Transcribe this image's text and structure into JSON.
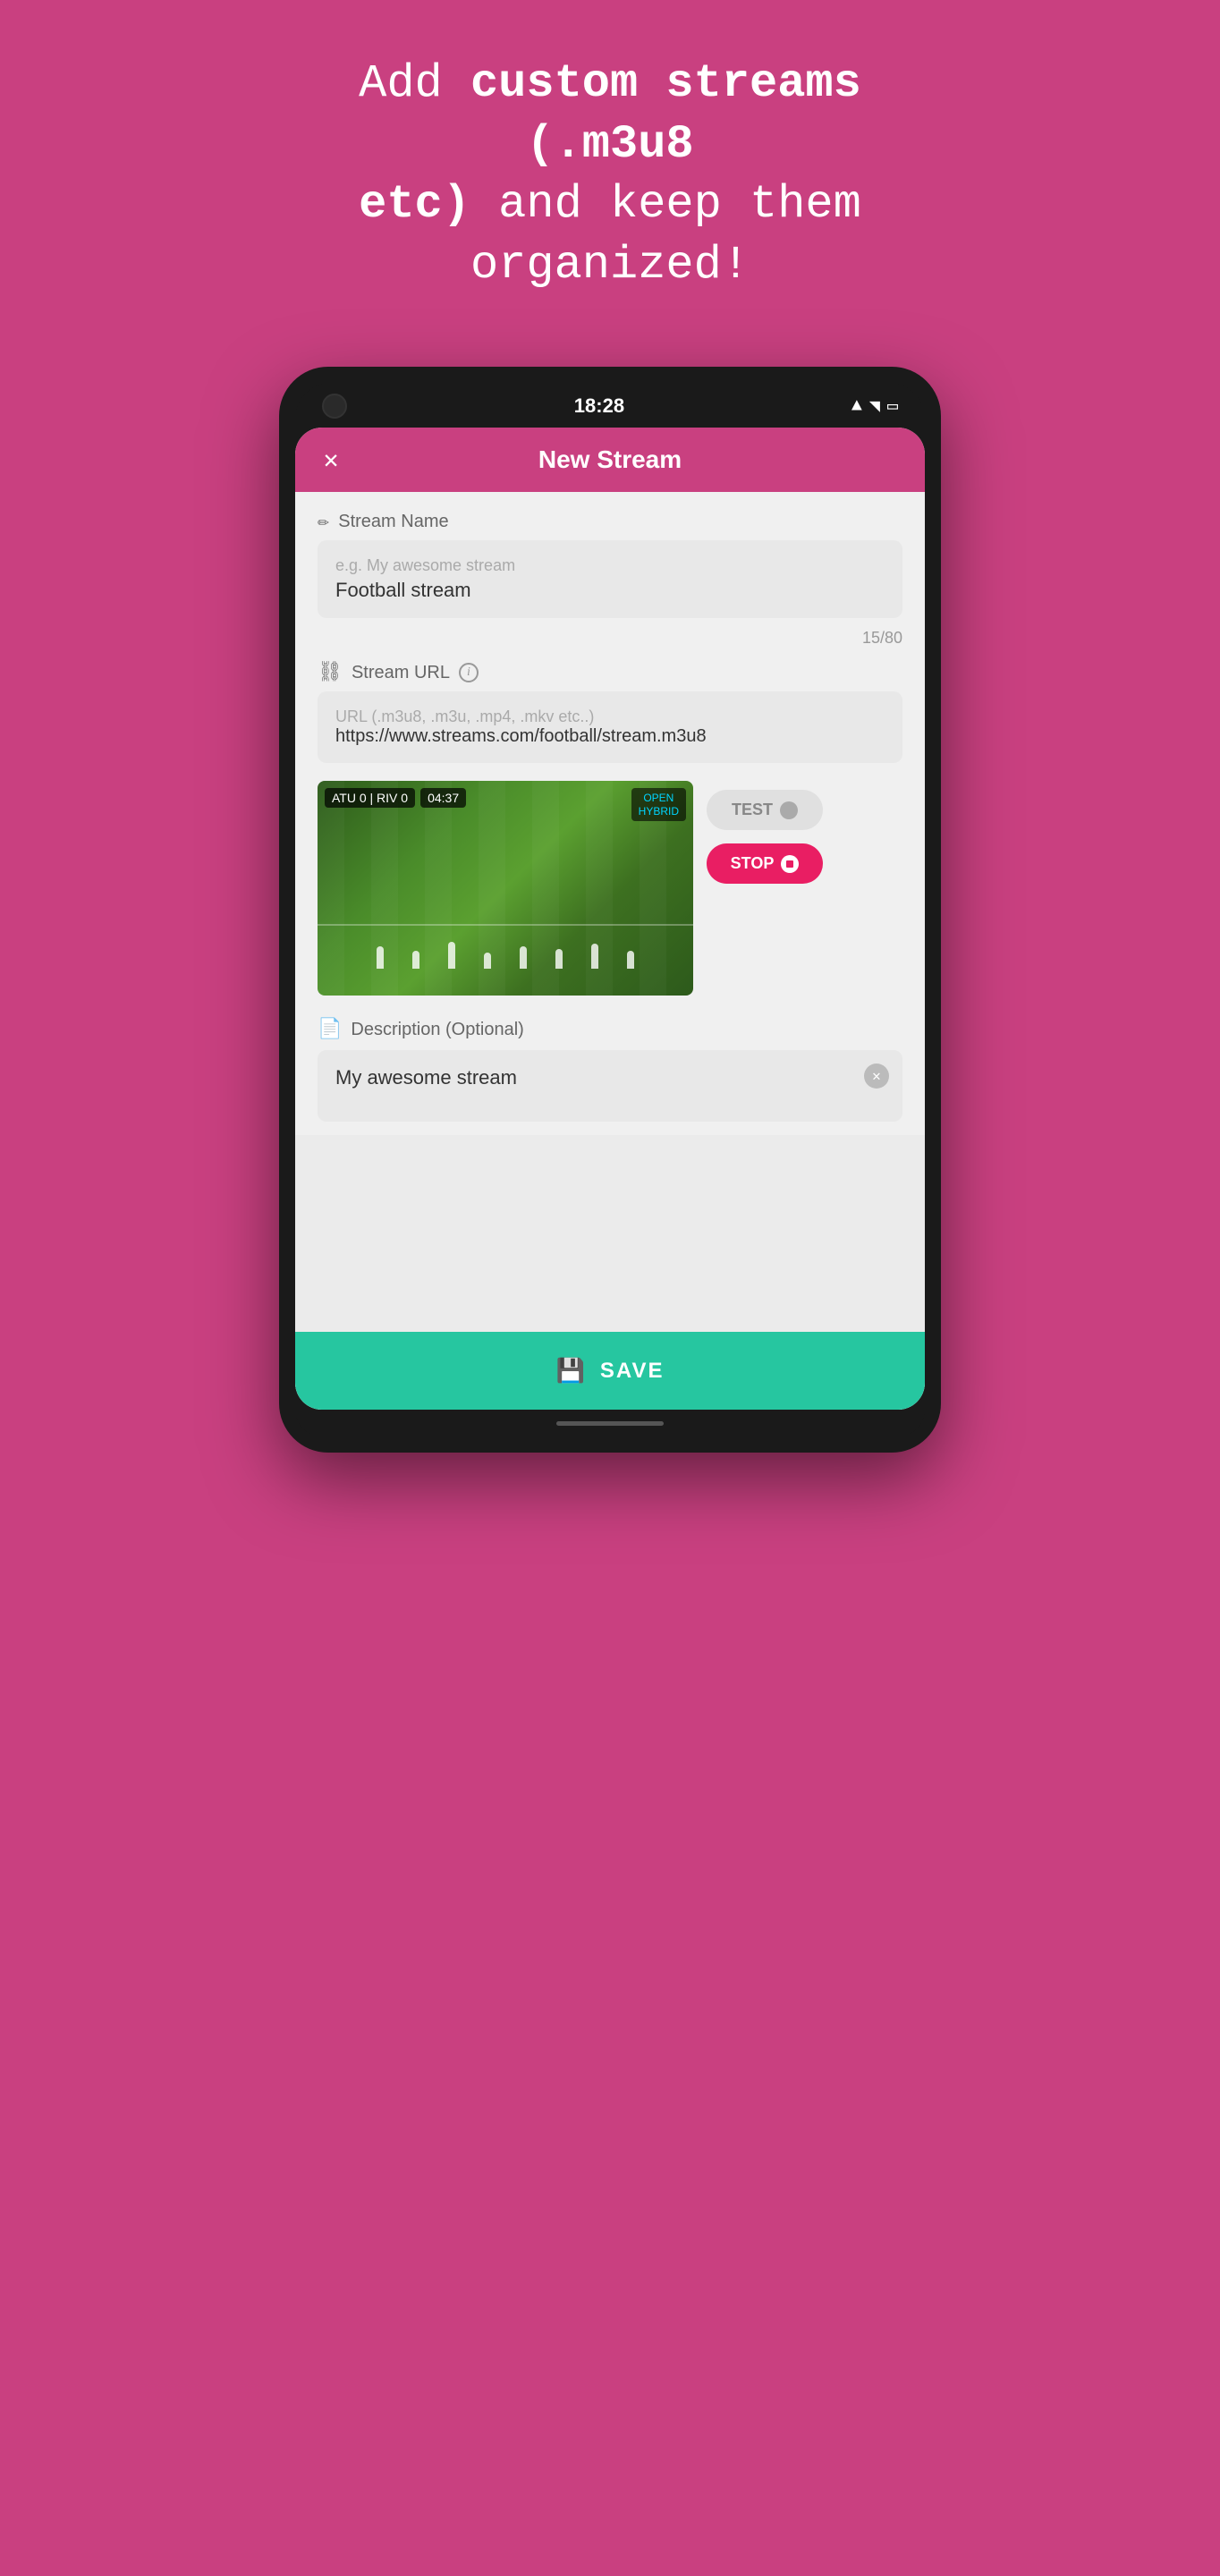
{
  "hero": {
    "line1_normal": "Add ",
    "line1_bold": "custom streams (.m3u8",
    "line2_bold": "etc)",
    "line2_normal": " and keep them organized!"
  },
  "status_bar": {
    "time": "18:28"
  },
  "app_header": {
    "title": "New Stream",
    "close_label": "×"
  },
  "stream_name": {
    "label": "Stream Name",
    "placeholder": "e.g. My awesome stream",
    "value": "Football stream",
    "char_count": "15/80"
  },
  "stream_url": {
    "label": "Stream URL",
    "placeholder": "URL (.m3u8, .m3u, .mp4, .mkv etc..)",
    "value": "https://www.streams.com/football/stream.m3u8"
  },
  "video": {
    "score_home": "ATU 0",
    "score_away": "RIV 0",
    "timer": "04:37",
    "badge": "OPEN HYBRID"
  },
  "buttons": {
    "test_label": "TEST",
    "stop_label": "STOP"
  },
  "description": {
    "label": "Description (Optional)",
    "value": "My awesome stream"
  },
  "save_button": {
    "label": "SAVE"
  }
}
